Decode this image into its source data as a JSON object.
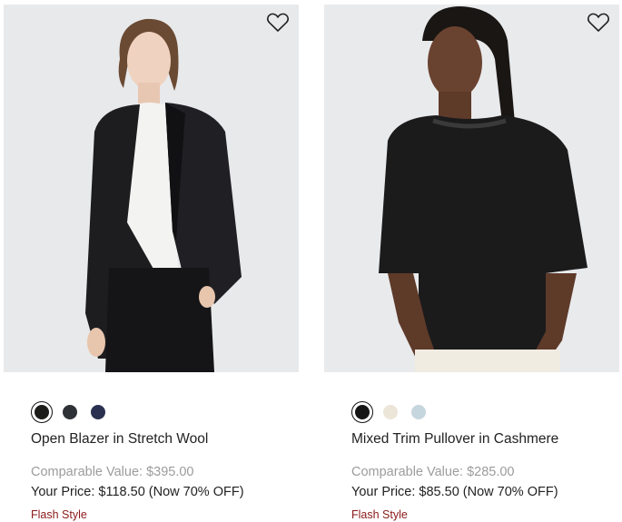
{
  "products": [
    {
      "name": "Open Blazer in Stretch Wool",
      "swatch_colors": [
        "#1c1c1a",
        "#2e3136",
        "#2a3150"
      ],
      "selected_swatch": 0,
      "comparable_value": "Comparable Value: $395.00",
      "your_price": "Your Price: $118.50 (Now 70% OFF)",
      "tag": "Flash Style",
      "wishlist_icon": "heart-outline-icon"
    },
    {
      "name": "Mixed Trim Pullover in Cashmere",
      "swatch_colors": [
        "#151515",
        "#ece6d8",
        "#c6d6de"
      ],
      "selected_swatch": 0,
      "comparable_value": "Comparable Value: $285.00",
      "your_price": "Your Price: $85.50 (Now 70% OFF)",
      "tag": "Flash Style",
      "wishlist_icon": "heart-outline-icon"
    }
  ],
  "colors": {
    "tag": "#8b1a1a",
    "muted": "#9c9c9c",
    "text": "#222222",
    "photo_bg": "#e9eaec"
  }
}
